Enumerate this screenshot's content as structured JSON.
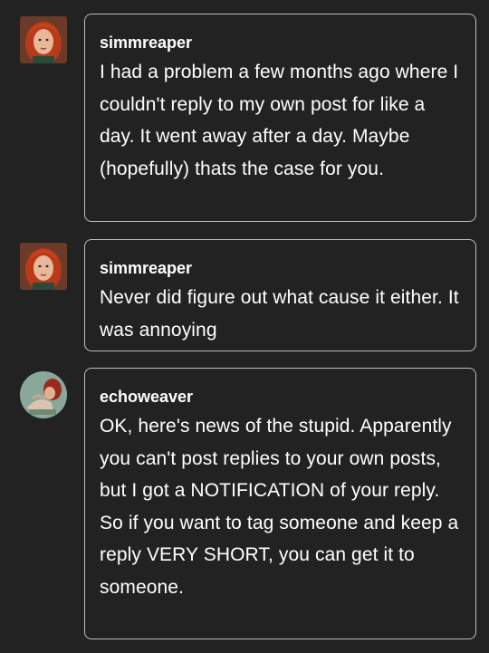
{
  "replies": [
    {
      "username": "simmreaper",
      "avatar_icon": "redhead-avatar-icon",
      "text": "I had a problem a few months ago where I couldn't reply to my own post for like a day. It went away after a day. Maybe (hopefully) thats the case for you."
    },
    {
      "username": "simmreaper",
      "avatar_icon": "redhead-avatar-icon",
      "text": "Never did figure out what cause it either. It was annoying"
    },
    {
      "username": "echoweaver",
      "avatar_icon": "character-avatar-icon",
      "text": "OK, here's news of the stupid. Apparently you can't post replies to your own posts, but I got a NOTIFICATION of your reply. So if you want to tag someone and keep a reply VERY SHORT, you can get it to someone."
    }
  ],
  "colors": {
    "background": "#222222",
    "bubble_border": "#bdbdbd",
    "text": "#ffffff"
  }
}
